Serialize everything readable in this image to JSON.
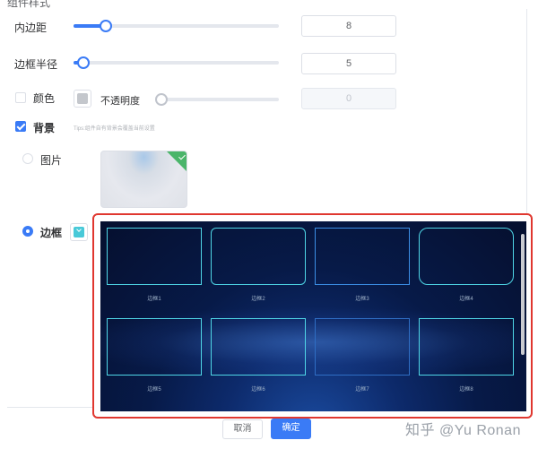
{
  "section": {
    "title": "组件样式"
  },
  "padding": {
    "label": "内边距",
    "value": "8",
    "slider_fraction": 0.16
  },
  "radius": {
    "label": "边框半径",
    "value": "5",
    "slider_fraction": 0.05
  },
  "color": {
    "label": "颜色",
    "checked": false,
    "opacity_label": "不透明度",
    "opacity_value": "0"
  },
  "background": {
    "label": "背景",
    "checked": true,
    "tips": "Tips:组件自有背景会覆盖当前设置"
  },
  "image": {
    "label": "图片",
    "selected": false
  },
  "border": {
    "label": "边框",
    "selected": true,
    "swatch_color": "#48c9d8"
  },
  "frames": [
    {
      "label": "边框1"
    },
    {
      "label": "边框2"
    },
    {
      "label": "边框3"
    },
    {
      "label": "边框4"
    },
    {
      "label": "边框5"
    },
    {
      "label": "边框6"
    },
    {
      "label": "边框7"
    },
    {
      "label": "边框8"
    }
  ],
  "footer": {
    "cancel_label": "取消",
    "ok_label": "确定"
  },
  "watermark": "知乎 @Yu Ronan",
  "colors": {
    "accent": "#3a7bf6",
    "highlight": "#e0372f",
    "check_green": "#4ab56a",
    "frame_cyan": "#4fd6e6"
  }
}
